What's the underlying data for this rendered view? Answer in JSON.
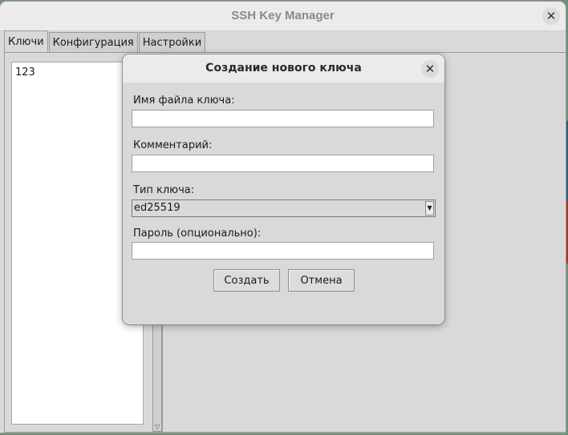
{
  "window": {
    "title": "SSH Key Manager",
    "close_icon": "close-icon"
  },
  "tabs": [
    {
      "label": "Ключи",
      "active": true
    },
    {
      "label": "Конфигурация",
      "active": false
    },
    {
      "label": "Настройки",
      "active": false
    }
  ],
  "key_list": {
    "items": [
      "123"
    ]
  },
  "dialog": {
    "title": "Создание нового ключа",
    "fields": {
      "filename_label": "Имя файла ключа:",
      "filename_value": "",
      "comment_label": "Комментарий:",
      "comment_value": "",
      "key_type_label": "Тип ключа:",
      "key_type_value": "ed25519",
      "password_label": "Пароль (опционально):",
      "password_value": ""
    },
    "buttons": {
      "create": "Создать",
      "cancel": "Отмена"
    }
  }
}
